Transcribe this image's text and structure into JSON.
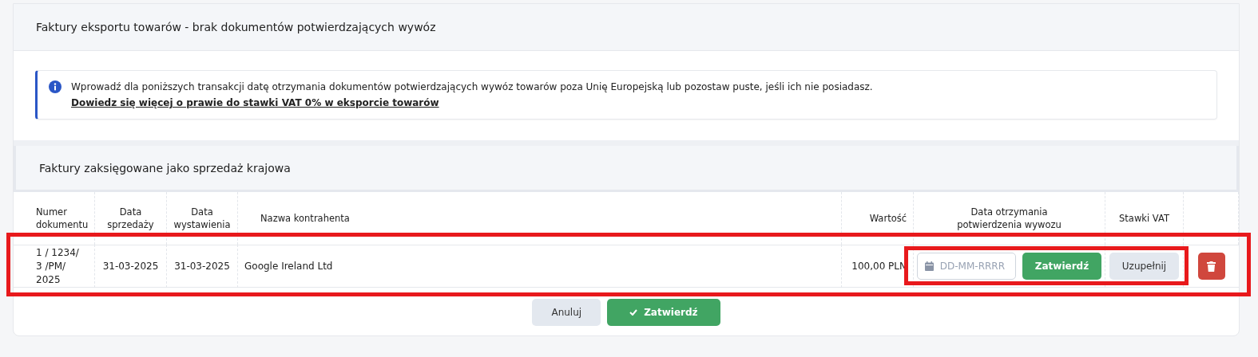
{
  "section_title": "Faktury eksportu towarów - brak dokumentów potwierdzających wywóz",
  "alert": {
    "text": "Wprowadź dla poniższych transakcji datę otrzymania dokumentów potwierdzających wywóz towarów poza Unię Europejską lub pozostaw puste, jeśli ich nie posiadasz.",
    "link": "Dowiedz się więcej o prawie do stawki VAT 0% w eksporcie towarów"
  },
  "subsection_title": "Faktury zaksięgowane jako sprzedaż krajowa",
  "table": {
    "columns": [
      {
        "lines": [
          "Numer",
          "dokumentu"
        ]
      },
      {
        "lines": [
          "Data",
          "sprzedaży"
        ]
      },
      {
        "lines": [
          "Data",
          "wystawienia"
        ]
      },
      {
        "lines": [
          "Nazwa kontrahenta"
        ]
      },
      {
        "lines": [
          "Wartość"
        ]
      },
      {
        "lines": [
          "Data otrzymania",
          "potwierdzenia wywozu"
        ]
      },
      {
        "lines": [
          "Stawki VAT"
        ]
      }
    ],
    "rows": [
      {
        "number": "1 / 1234/ 3 /PM/ 2025",
        "sale_date": "31-03-2025",
        "issue_date": "31-03-2025",
        "contractor": "Google Ireland Ltd",
        "value": "100,00 PLN",
        "date_placeholder": "DD-MM-RRRR",
        "confirm": "Zatwierdź",
        "fill": "Uzupełnij"
      }
    ]
  },
  "footer_buttons": [
    {
      "kind": "secondary",
      "label": "Anuluj"
    },
    {
      "kind": "primary",
      "label": "Zatwierdź"
    }
  ],
  "annotations": [
    {
      "kind": "frame"
    },
    {
      "kind": "frame"
    }
  ]
}
